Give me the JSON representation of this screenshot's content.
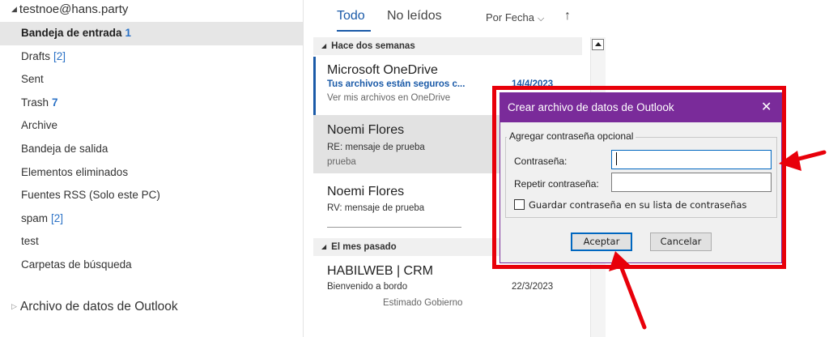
{
  "account": "testnoe@hans.party",
  "folders": [
    {
      "name": "Bandeja de entrada",
      "count": "1"
    },
    {
      "name": "Drafts",
      "count": "[2]"
    },
    {
      "name": "Sent",
      "count": ""
    },
    {
      "name": "Trash",
      "count": "7"
    },
    {
      "name": "Archive",
      "count": ""
    },
    {
      "name": "Bandeja de salida",
      "count": ""
    },
    {
      "name": "Elementos eliminados",
      "count": ""
    },
    {
      "name": "Fuentes RSS (Solo este PC)",
      "count": ""
    },
    {
      "name": "spam",
      "count": "[2]"
    },
    {
      "name": "test",
      "count": ""
    },
    {
      "name": "Carpetas de búsqueda",
      "count": ""
    }
  ],
  "data_file": "Archivo de datos de Outlook",
  "list": {
    "tabs": [
      "Todo",
      "No leídos"
    ],
    "sort_label": "Por Fecha",
    "sort_arrow": "↑",
    "groups": [
      "Hace dos semanas",
      "El mes pasado"
    ],
    "messages": [
      {
        "from": "Microsoft OneDrive",
        "subject": "Tus archivos están seguros c...",
        "date": "14/4/2023",
        "preview": "Ver mis archivos en OneDrive"
      },
      {
        "from": "Noemi Flores",
        "subject": "RE: mensaje de prueba",
        "preview": "prueba"
      },
      {
        "from": "Noemi Flores",
        "subject": "RV: mensaje de prueba"
      },
      {
        "from": "HABILWEB | CRM",
        "subject": "Bienvenido a bordo",
        "date": "22/3/2023",
        "preview": "Estimado Gobierno"
      }
    ]
  },
  "dialog": {
    "title": "Crear archivo de datos de Outlook",
    "group_label": "Agregar contraseña opcional",
    "password_label": "Contraseña:",
    "password_value": "",
    "repeat_label": "Repetir contraseña:",
    "repeat_value": "",
    "save_label": "Guardar contraseña en su lista de contraseñas",
    "save_checked": false,
    "ok_label": "Aceptar",
    "cancel_label": "Cancelar"
  },
  "colors": {
    "accent": "#1a5aa8",
    "dialog_title": "#7a2b9a",
    "annotation": "#e8000a"
  }
}
